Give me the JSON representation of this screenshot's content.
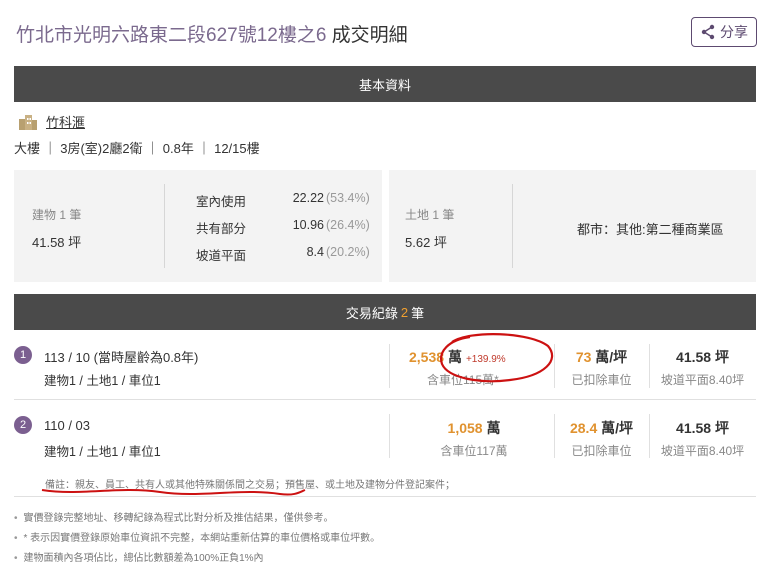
{
  "header": {
    "address": "竹北市光明六路東二段627號12樓之6",
    "suffix": " 成交明細",
    "share_label": "分享"
  },
  "basic": {
    "bar_label": "基本資料",
    "community_name": "竹科滙",
    "spec": "大樓 ｜ 3房(室)2廳2衛 ｜ 0.8年 ｜ 12/15樓"
  },
  "building": {
    "label": "建物 1 筆",
    "area": "41.58 坪",
    "rows": [
      {
        "key": "室內使用",
        "value": "22.22",
        "pct": "(53.4%)"
      },
      {
        "key": "共有部分",
        "value": "10.96",
        "pct": "(26.4%)"
      },
      {
        "key": "坡道平面",
        "value": "8.4",
        "pct": "(20.2%)"
      }
    ]
  },
  "land": {
    "label": "土地 1 筆",
    "area": "5.62 坪",
    "zone": "都市：其他:第二種商業區"
  },
  "trades": {
    "bar_prefix": "交易紀錄",
    "count": "2",
    "bar_suffix": "筆",
    "records": [
      {
        "index": "1",
        "date": "113 / 10 (當時屋齡為0.8年)",
        "detail": "建物1 / 土地1 / 車位1",
        "total": "2,538",
        "total_unit": "萬",
        "change": "+139.9%",
        "total_sub": "含車位115萬*",
        "unit_price": "73",
        "unit_price_unit": "萬/坪",
        "unit_sub": "已扣除車位",
        "area": "41.58 坪",
        "area_sub": "坡道平面8.40坪"
      },
      {
        "index": "2",
        "date": "110 / 03",
        "detail": "建物1 / 土地1 / 車位1",
        "total": "1,058",
        "total_unit": "萬",
        "total_sub": "含車位117萬",
        "unit_price": "28.4",
        "unit_price_unit": "萬/坪",
        "unit_sub": "已扣除車位",
        "area": "41.58 坪",
        "area_sub": "坡道平面8.40坪"
      }
    ],
    "remark": "備註：親友、員工、共有人或其他特殊關係間之交易；預售屋、或土地及建物分件登記案件；"
  },
  "footnotes": [
    "實價登錄完整地址、移轉紀錄為程式比對分析及推估結果，僅供參考。",
    "* 表示因實價登錄原始車位資訊不完整，本網站重新估算的車位價格或車位坪數。",
    "建物面積內各項佔比，總佔比數額差為100%正負1%內"
  ],
  "colors": {
    "bar_bg": "#4a4a4a",
    "accent_orange": "#e0922f",
    "badge_purple": "#7b5f90",
    "annotation_red": "#cc1111"
  }
}
